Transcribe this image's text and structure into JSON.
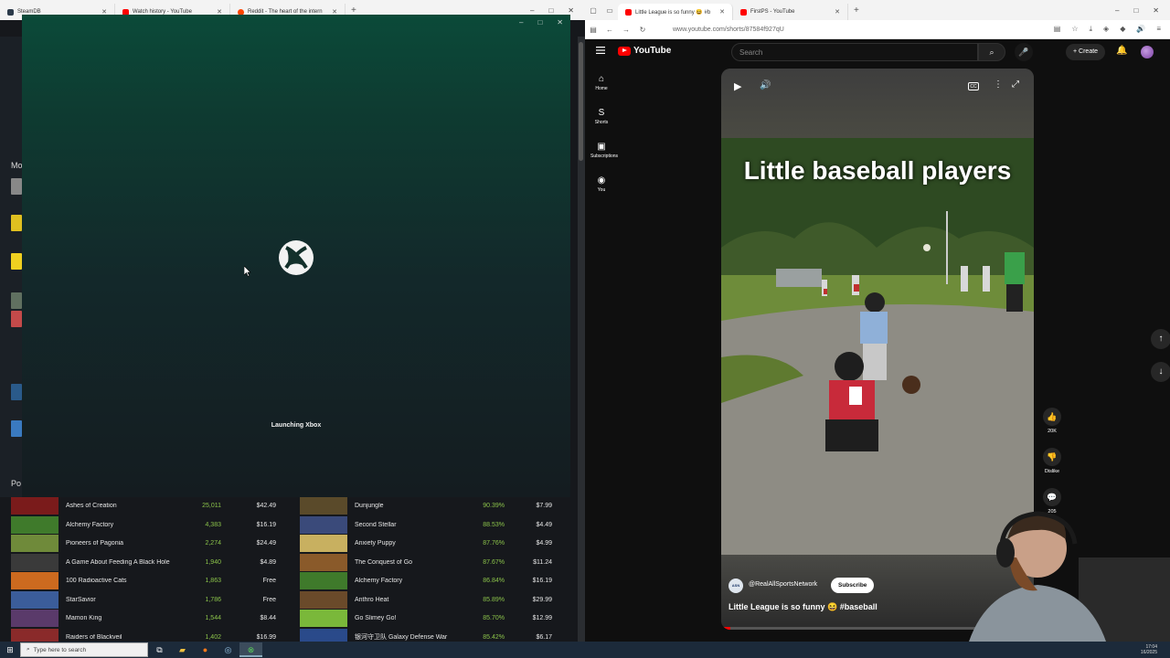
{
  "left_browser": {
    "tabs": [
      {
        "label": "SteamDB",
        "color": "#2b3a4a",
        "active": false
      },
      {
        "label": "Watch history - YouTube",
        "color": "#ff0000",
        "active": false
      },
      {
        "label": "Reddit - The heart of the intern",
        "color": "#ff4500",
        "active": false
      }
    ],
    "newtab": "+"
  },
  "xbox": {
    "status_text": "Launching Xbox",
    "controls": [
      "–",
      "□",
      "✕"
    ]
  },
  "steamdb": {
    "section_label_top": "Mo",
    "section_label_popular": "Po",
    "left_list": [
      {
        "name": "Ashes of Creation",
        "players": "25,011",
        "price": "$42.49",
        "thumb": "#7a1b1b"
      },
      {
        "name": "Alchemy Factory",
        "players": "4,383",
        "price": "$16.19",
        "thumb": "#3f7a2b"
      },
      {
        "name": "Pioneers of Pagonia",
        "players": "2,274",
        "price": "$24.49",
        "thumb": "#6f8a3a"
      },
      {
        "name": "A Game About Feeding A Black Hole",
        "players": "1,940",
        "price": "$4.89",
        "thumb": "#3a3a3a"
      },
      {
        "name": "100 Radioactive Cats",
        "players": "1,863",
        "price": "Free",
        "thumb": "#cc6a1f"
      },
      {
        "name": "StarSavior",
        "players": "1,786",
        "price": "Free",
        "thumb": "#3b5d9a"
      },
      {
        "name": "Mamon King",
        "players": "1,544",
        "price": "$8.44",
        "thumb": "#5a3a6a"
      },
      {
        "name": "Raiders of Blackveil",
        "players": "1,402",
        "price": "$16.99",
        "thumb": "#8a2a2a"
      }
    ],
    "right_list": [
      {
        "name": "Dunjungle",
        "pct": "90.39%",
        "price": "$7.99",
        "thumb": "#5a4a2a"
      },
      {
        "name": "Second Stellar",
        "pct": "88.53%",
        "price": "$4.49",
        "thumb": "#3a4a7a"
      },
      {
        "name": "Anxiety Puppy",
        "pct": "87.76%",
        "price": "$4.99",
        "thumb": "#c8b060"
      },
      {
        "name": "The Conquest of Go",
        "pct": "87.67%",
        "price": "$11.24",
        "thumb": "#8a5a2a"
      },
      {
        "name": "Alchemy Factory",
        "pct": "86.84%",
        "price": "$16.19",
        "thumb": "#3f7a2b"
      },
      {
        "name": "Anthro Heat",
        "pct": "85.89%",
        "price": "$29.99",
        "thumb": "#6a4a2a"
      },
      {
        "name": "Go Slimey Go!",
        "pct": "85.70%",
        "price": "$12.99",
        "thumb": "#7ab83a"
      },
      {
        "name": "银河守卫队 Galaxy Defense War",
        "pct": "85.42%",
        "price": "$6.17",
        "thumb": "#2a4a8a"
      }
    ]
  },
  "right_browser": {
    "tabs": [
      {
        "label": "Little League is so funny 😆 #b",
        "color": "#ff0000",
        "active": true
      },
      {
        "label": "FirstPS - YouTube",
        "color": "#ff0000",
        "active": false
      }
    ],
    "newtab": "+",
    "url": "www.youtube.com/shorts/87584f927qU"
  },
  "youtube": {
    "logo_text": "YouTube",
    "search_placeholder": "Search",
    "create_label": "Create",
    "nav": [
      {
        "icon": "⌂",
        "label": "Home"
      },
      {
        "icon": "S",
        "label": "Shorts"
      },
      {
        "icon": "▣",
        "label": "Subscriptions"
      },
      {
        "icon": "◉",
        "label": "You"
      }
    ],
    "short": {
      "overlay_title": "Little baseball players",
      "channel": "@RealAllSportsNetwork",
      "channel_avatar_text": "ASN",
      "subscribe_label": "Subscribe",
      "caption": "Little League is so funny 😆 #baseball",
      "progress": 0.03
    },
    "actions": [
      {
        "icon": "👍",
        "label": "20K"
      },
      {
        "icon": "👎",
        "label": "Dislike"
      },
      {
        "icon": "💬",
        "label": "205"
      }
    ]
  },
  "taskbar": {
    "search_placeholder": "Type here to search",
    "clock_time": "17:04",
    "clock_date": "16/2025"
  },
  "colors": {
    "xbox_green": "#0b4a39",
    "yt_red": "#ff0000",
    "steam_green": "#8bc34a"
  }
}
